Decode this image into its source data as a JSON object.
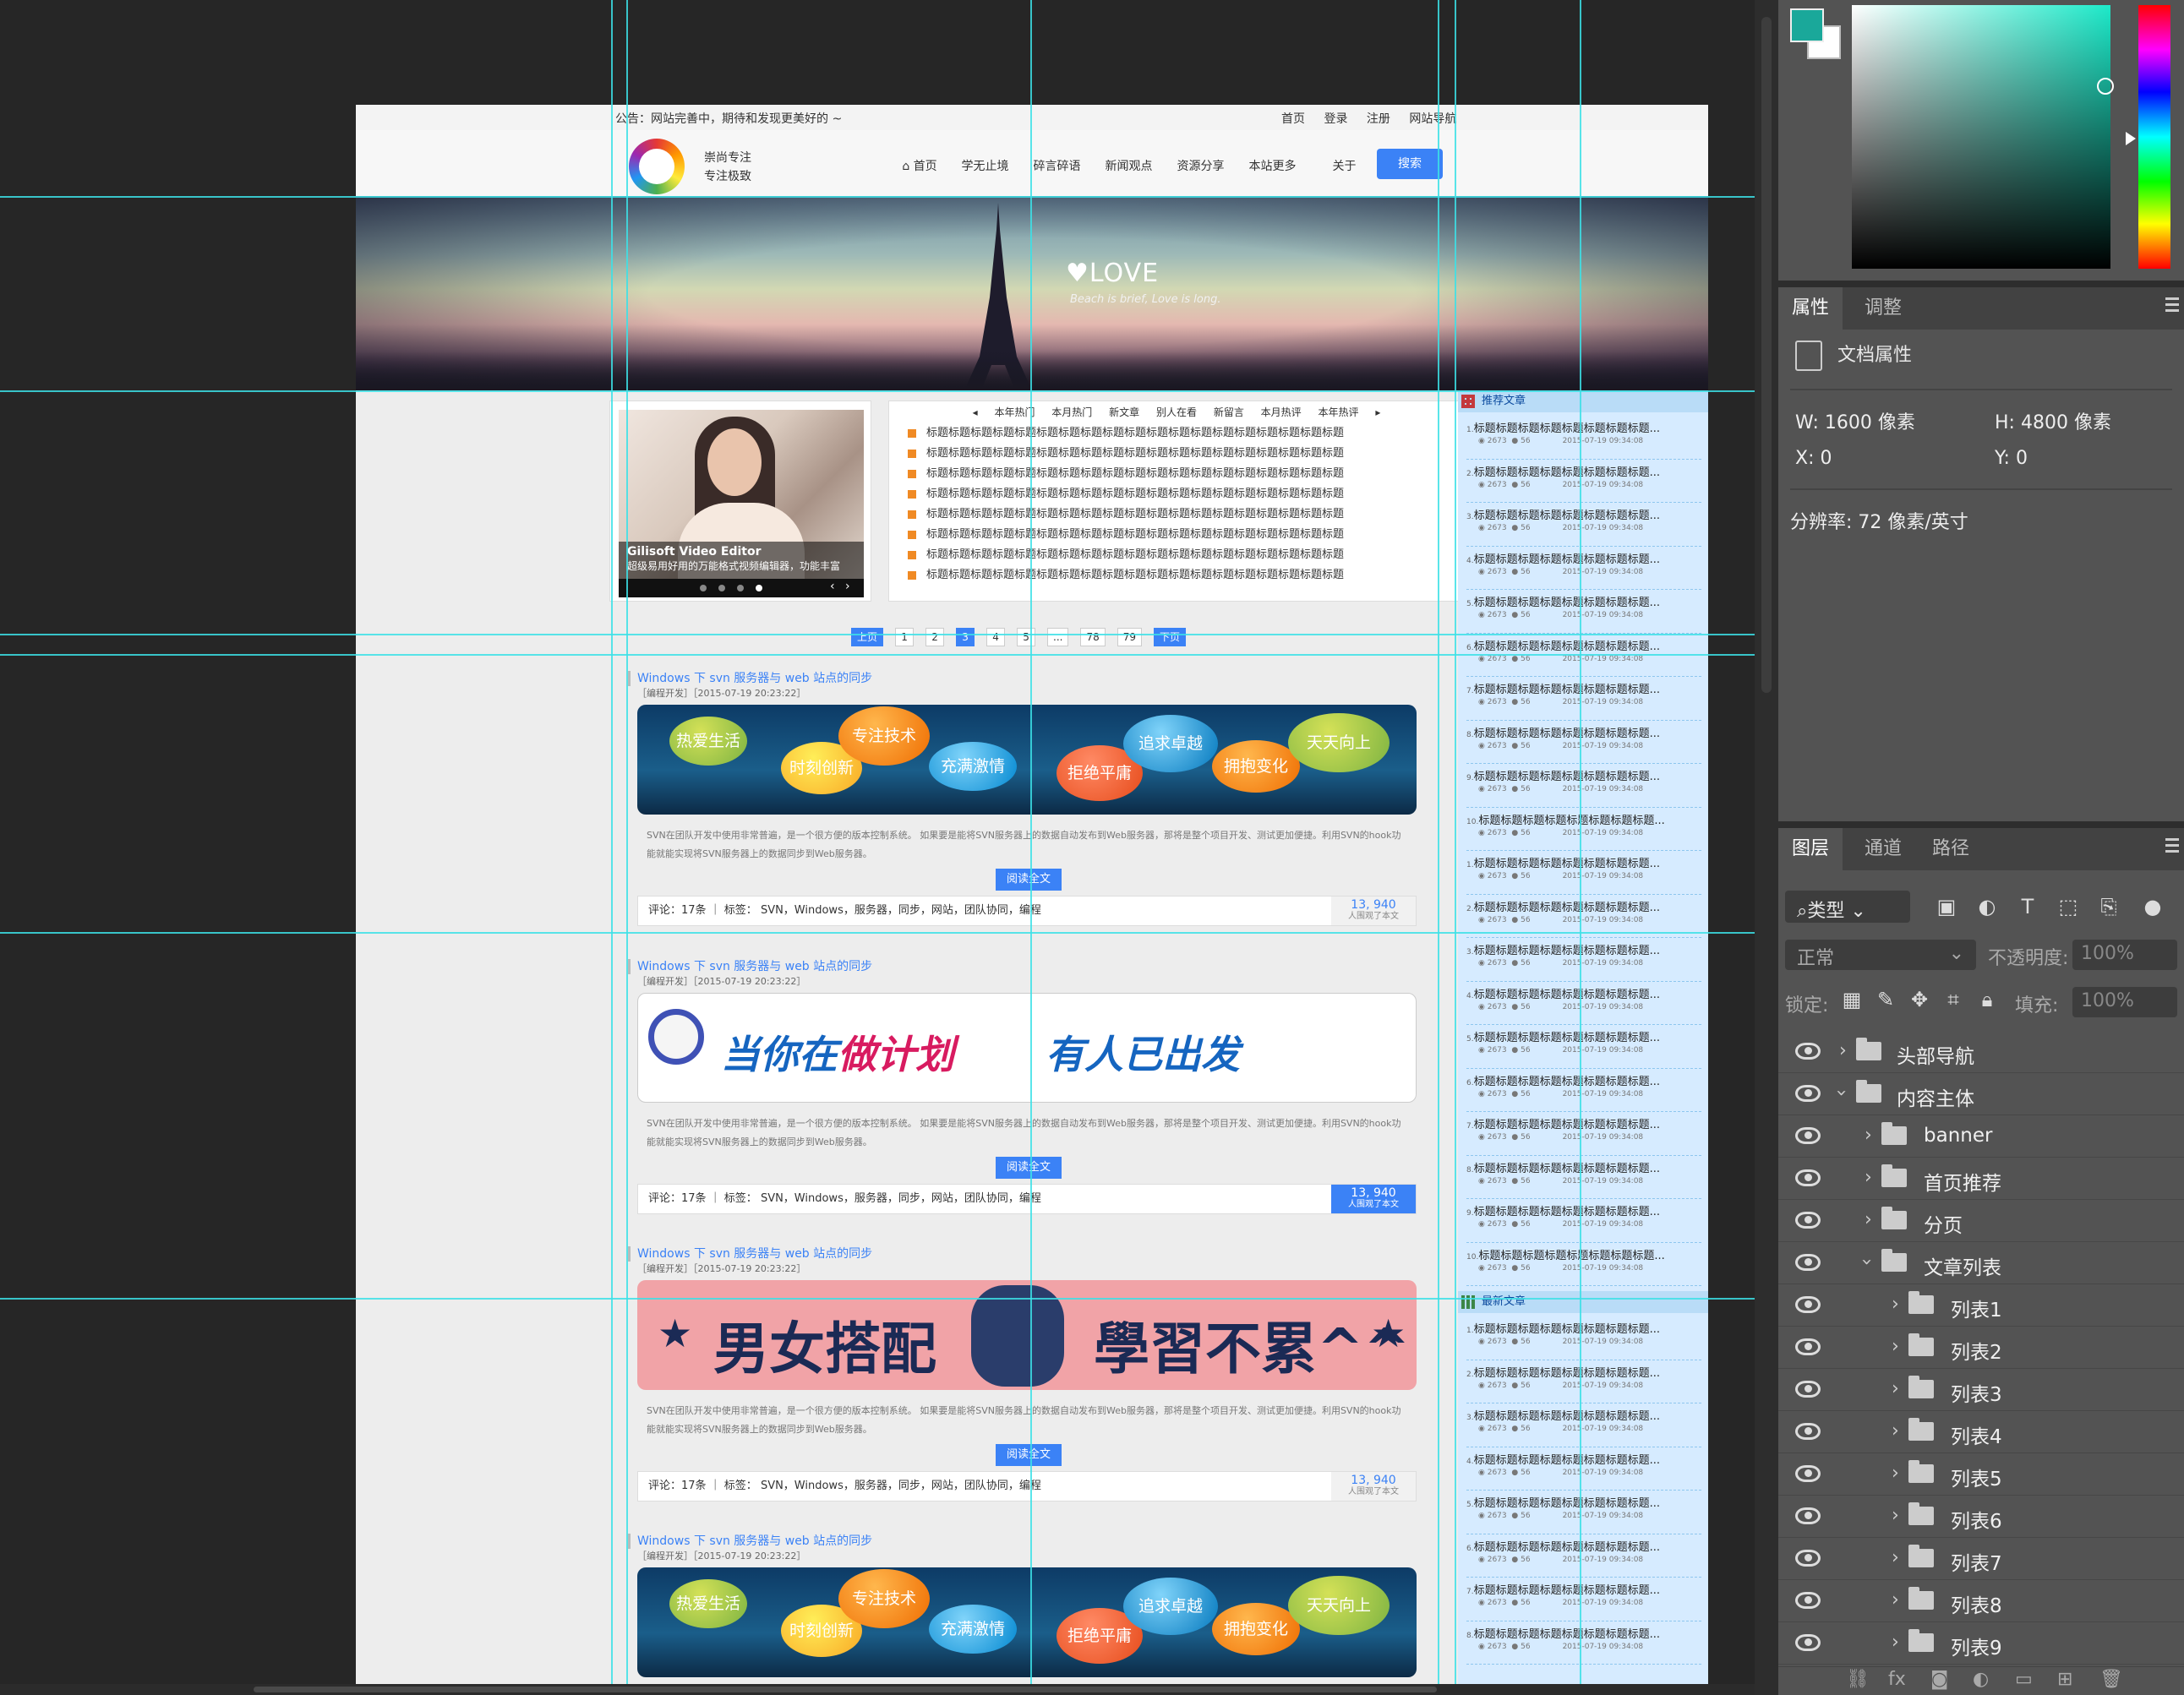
{
  "site": {
    "notice": "公告：网站完善中，期待和发现更美好的 ~",
    "toplinks": [
      "首页",
      "登录",
      "注册",
      "网站导航"
    ],
    "slogan_line1": "崇尚专注",
    "slogan_line2": "专注极致",
    "nav": [
      "首页",
      "学无止境",
      "碎言碎语",
      "新闻观点",
      "资源分享",
      "本站更多",
      "关于"
    ],
    "search_label": "搜索",
    "banner": {
      "title": "LOVE",
      "subtitle": "Beach is brief, Love is long."
    },
    "slider": {
      "title": "Gilisoft Video Editor",
      "desc": "超级易用好用的万能格式视频编辑器，功能丰富"
    },
    "hot_tabs": [
      "本年热门",
      "本月热门",
      "新文章",
      "别人在看",
      "新留言",
      "本月热评",
      "本年热评"
    ],
    "hot_prev": "◂",
    "hot_next": "▸",
    "hot_items": [
      "标题标题标题标题标题标题标题标题标题标题标题标题标题标题标题标题标题标题标题",
      "标题标题标题标题标题标题标题标题标题标题标题标题标题标题标题标题标题标题标题",
      "标题标题标题标题标题标题标题标题标题标题标题标题标题标题标题标题标题标题标题",
      "标题标题标题标题标题标题标题标题标题标题标题标题标题标题标题标题标题标题标题",
      "标题标题标题标题标题标题标题标题标题标题标题标题标题标题标题标题标题标题标题",
      "标题标题标题标题标题标题标题标题标题标题标题标题标题标题标题标题标题标题标题",
      "标题标题标题标题标题标题标题标题标题标题标题标题标题标题标题标题标题标题标题",
      "标题标题标题标题标题标题标题标题标题标题标题标题标题标题标题标题标题标题标题"
    ],
    "pager": [
      "上页",
      "1",
      "2",
      "3",
      "4",
      "5",
      "...",
      "78",
      "79",
      "下页"
    ],
    "pager_current": "3",
    "articles": [
      {
        "title": "Windows 下 svn 服务器与 web 站点的同步",
        "cat": "［编程开发］［2015-07-19 20:23:22］",
        "excerpt": "SVN在团队开发中使用非常普遍，是一个很方便的版本控制系统。 如果要是能将SVN服务器上的数据自动发布到Web服务器，那将是整个项目开发、测试更加便捷。利用SVN的hook功能就能实现将SVN服务器上的数据同步到Web服务器。",
        "more": "阅读全文",
        "foot": "评论：17条 ｜ 标签： SVN，Windows，服务器，同步，网站，团队协同，编程",
        "count": "13, 940",
        "count_sub": "人围观了本文",
        "image": "bubbles"
      },
      {
        "title": "Windows 下 svn 服务器与 web 站点的同步",
        "cat": "［编程开发］［2015-07-19 20:23:22］",
        "excerpt": "SVN在团队开发中使用非常普遍，是一个很方便的版本控制系统。 如果要是能将SVN服务器上的数据自动发布到Web服务器，那将是整个项目开发、测试更加便捷。利用SVN的hook功能就能实现将SVN服务器上的数据同步到Web服务器。",
        "more": "阅读全文",
        "foot": "评论：17条 ｜ 标签： SVN，Windows，服务器，同步，网站，团队协同，编程",
        "count": "13, 940",
        "count_sub": "人围观了本文",
        "image": "plan"
      },
      {
        "title": "Windows 下 svn 服务器与 web 站点的同步",
        "cat": "［编程开发］［2015-07-19 20:23:22］",
        "excerpt": "SVN在团队开发中使用非常普遍，是一个很方便的版本控制系统。 如果要是能将SVN服务器上的数据自动发布到Web服务器，那将是整个项目开发、测试更加便捷。利用SVN的hook功能就能实现将SVN服务器上的数据同步到Web服务器。",
        "more": "阅读全文",
        "foot": "评论：17条 ｜ 标签： SVN，Windows，服务器，同步，网站，团队协同，编程",
        "count": "13, 940",
        "count_sub": "人围观了本文",
        "image": "pink"
      },
      {
        "title": "Windows 下 svn 服务器与 web 站点的同步",
        "cat": "［编程开发］［2015-07-19 20:23:22］",
        "excerpt": "",
        "more": "",
        "foot": "",
        "count": "",
        "count_sub": "",
        "image": "bubbles"
      }
    ],
    "bubbles": [
      "热爱生活",
      "时刻创新",
      "专注技术",
      "充满激情",
      "拒绝平庸",
      "追求卓越",
      "拥抱变化",
      "天天向上"
    ],
    "plan_text1a": "当你在",
    "plan_text1b": "做计划",
    "plan_text2": "有人已出发",
    "pink_text1": "男女搭配",
    "pink_text2": "學習不累^^",
    "side_recommend": "推荐文章",
    "side_latest": "最新文章",
    "side_item_title": "标题标题标题标题标题标题标题标题...",
    "side_item_views": "2673",
    "side_item_comments": "56",
    "side_item_date": "2015-07-19 09:34:08"
  },
  "ps": {
    "props_tabs": [
      "属性",
      "调整"
    ],
    "doc_props": "文档属性",
    "w_label": "W:",
    "w_value": "1600 像素",
    "h_label": "H:",
    "h_value": "4800 像素",
    "x_label": "X:",
    "x_value": "0",
    "y_label": "Y:",
    "y_value": "0",
    "resolution": "分辨率: 72 像素/英寸",
    "layers_tabs": [
      "图层",
      "通道",
      "路径"
    ],
    "filter_kind": "类型",
    "blend_mode": "正常",
    "opacity_label": "不透明度:",
    "opacity_value": "100%",
    "lock_label": "锁定:",
    "fill_label": "填充:",
    "fill_value": "100%",
    "layers": [
      "头部导航",
      "内容主体",
      "banner",
      "首页推荐",
      "分页",
      "文章列表",
      "列表1",
      "列表2",
      "列表3",
      "列表4",
      "列表5",
      "列表6",
      "列表7",
      "列表8",
      "列表9"
    ],
    "fg_color": "#1aa89a",
    "bg_color": "#ffffff"
  }
}
